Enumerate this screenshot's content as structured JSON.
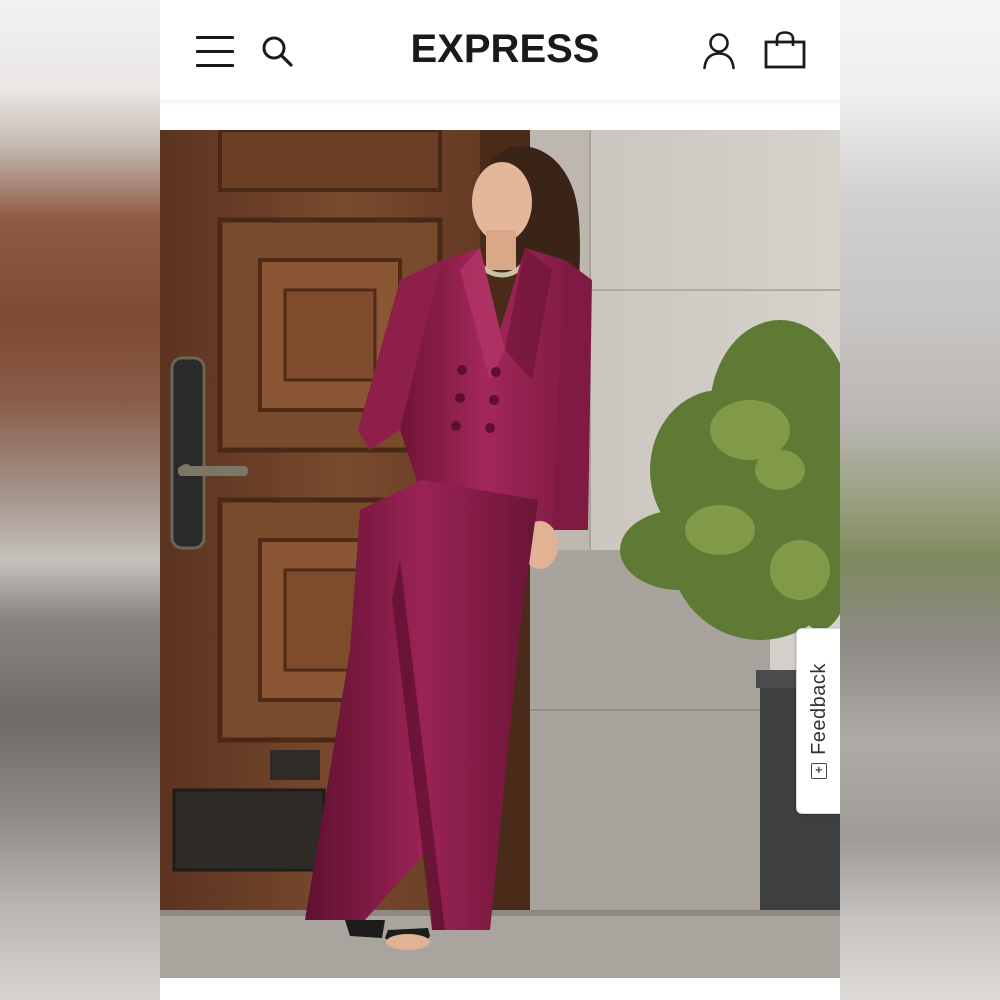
{
  "brand": {
    "logo_text": "EXPRESS"
  },
  "header": {
    "icons": [
      "menu-icon",
      "search-icon",
      "account-icon",
      "shopping-bag-icon"
    ]
  },
  "hero": {
    "image_subject": "product photo",
    "colors": {
      "suit": "#8e1f48",
      "door": "#6e4128",
      "stone": "#bdb8b1"
    }
  },
  "feedback": {
    "label": "Feedback",
    "icon": "feedback-plus-icon"
  }
}
